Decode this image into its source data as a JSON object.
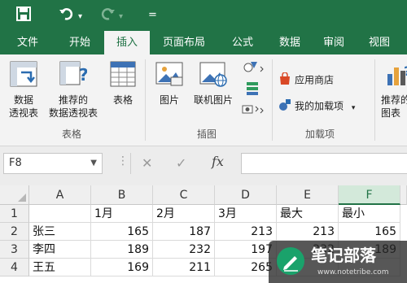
{
  "quick_access": {
    "customize": "="
  },
  "tabs": [
    "文件",
    "开始",
    "插入",
    "页面布局",
    "公式",
    "数据",
    "审阅",
    "视图"
  ],
  "active_tab": "插入",
  "ribbon": {
    "pivot_table": "数据\n透视表",
    "recommended_pivot": "推荐的\n数据透视表",
    "table": "表格",
    "group_tables": "表格",
    "pictures": "图片",
    "online_pictures": "联机图片",
    "group_illustrations": "插图",
    "app_store": "应用商店",
    "my_addins": "我的加载项",
    "group_addins": "加载项",
    "recommended_charts": "推荐的\n图表"
  },
  "formula_bar": {
    "name_box": "F8",
    "fx": "fx",
    "formula": ""
  },
  "grid": {
    "columns": [
      "A",
      "B",
      "C",
      "D",
      "E",
      "F"
    ],
    "selected_column": "F",
    "rows": [
      {
        "num": "1",
        "cells": [
          "",
          "1月",
          "2月",
          "3月",
          "最大",
          "最小"
        ]
      },
      {
        "num": "2",
        "cells": [
          "张三",
          "165",
          "187",
          "213",
          "213",
          "165"
        ]
      },
      {
        "num": "3",
        "cells": [
          "李四",
          "189",
          "232",
          "197",
          "232",
          "189"
        ]
      },
      {
        "num": "4",
        "cells": [
          "王五",
          "169",
          "211",
          "265",
          "",
          ""
        ]
      }
    ]
  },
  "watermark": {
    "title": "笔记部落",
    "url": "www.notetribe.com"
  }
}
